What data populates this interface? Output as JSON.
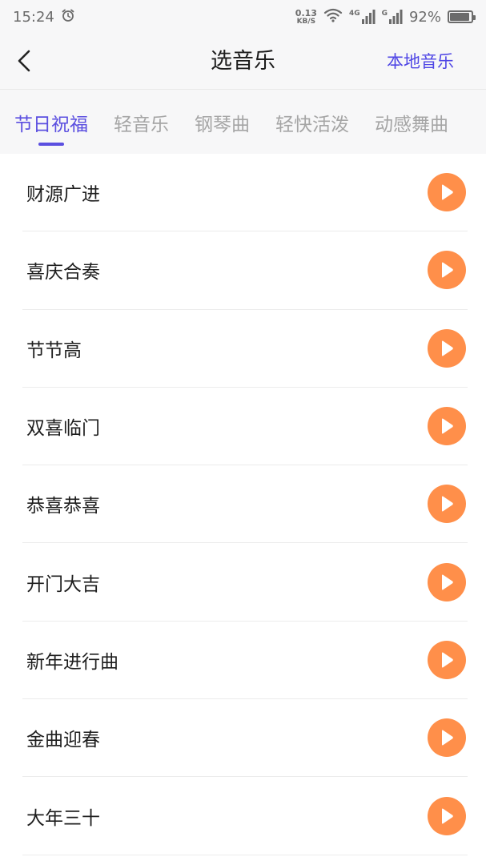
{
  "status_bar": {
    "time": "15:24",
    "net_speed_value": "0.13",
    "net_speed_unit": "KB/S",
    "signal_1_label": "4G",
    "signal_2_label": "G",
    "battery_percent": "92%",
    "battery_level": 0.92
  },
  "header": {
    "title": "选音乐",
    "local_music_label": "本地音乐"
  },
  "tabs": [
    {
      "label": "节日祝福",
      "active": true
    },
    {
      "label": "轻音乐",
      "active": false
    },
    {
      "label": "钢琴曲",
      "active": false
    },
    {
      "label": "轻快活泼",
      "active": false
    },
    {
      "label": "动感舞曲",
      "active": false
    }
  ],
  "songs": [
    {
      "title": "财源广进"
    },
    {
      "title": "喜庆合奏"
    },
    {
      "title": "节节高"
    },
    {
      "title": "双喜临门"
    },
    {
      "title": "恭喜恭喜"
    },
    {
      "title": "开门大吉"
    },
    {
      "title": "新年进行曲"
    },
    {
      "title": "金曲迎春"
    },
    {
      "title": "大年三十"
    }
  ],
  "colors": {
    "accent": "#5b4fe0",
    "play_button": "#ff8f4a"
  }
}
